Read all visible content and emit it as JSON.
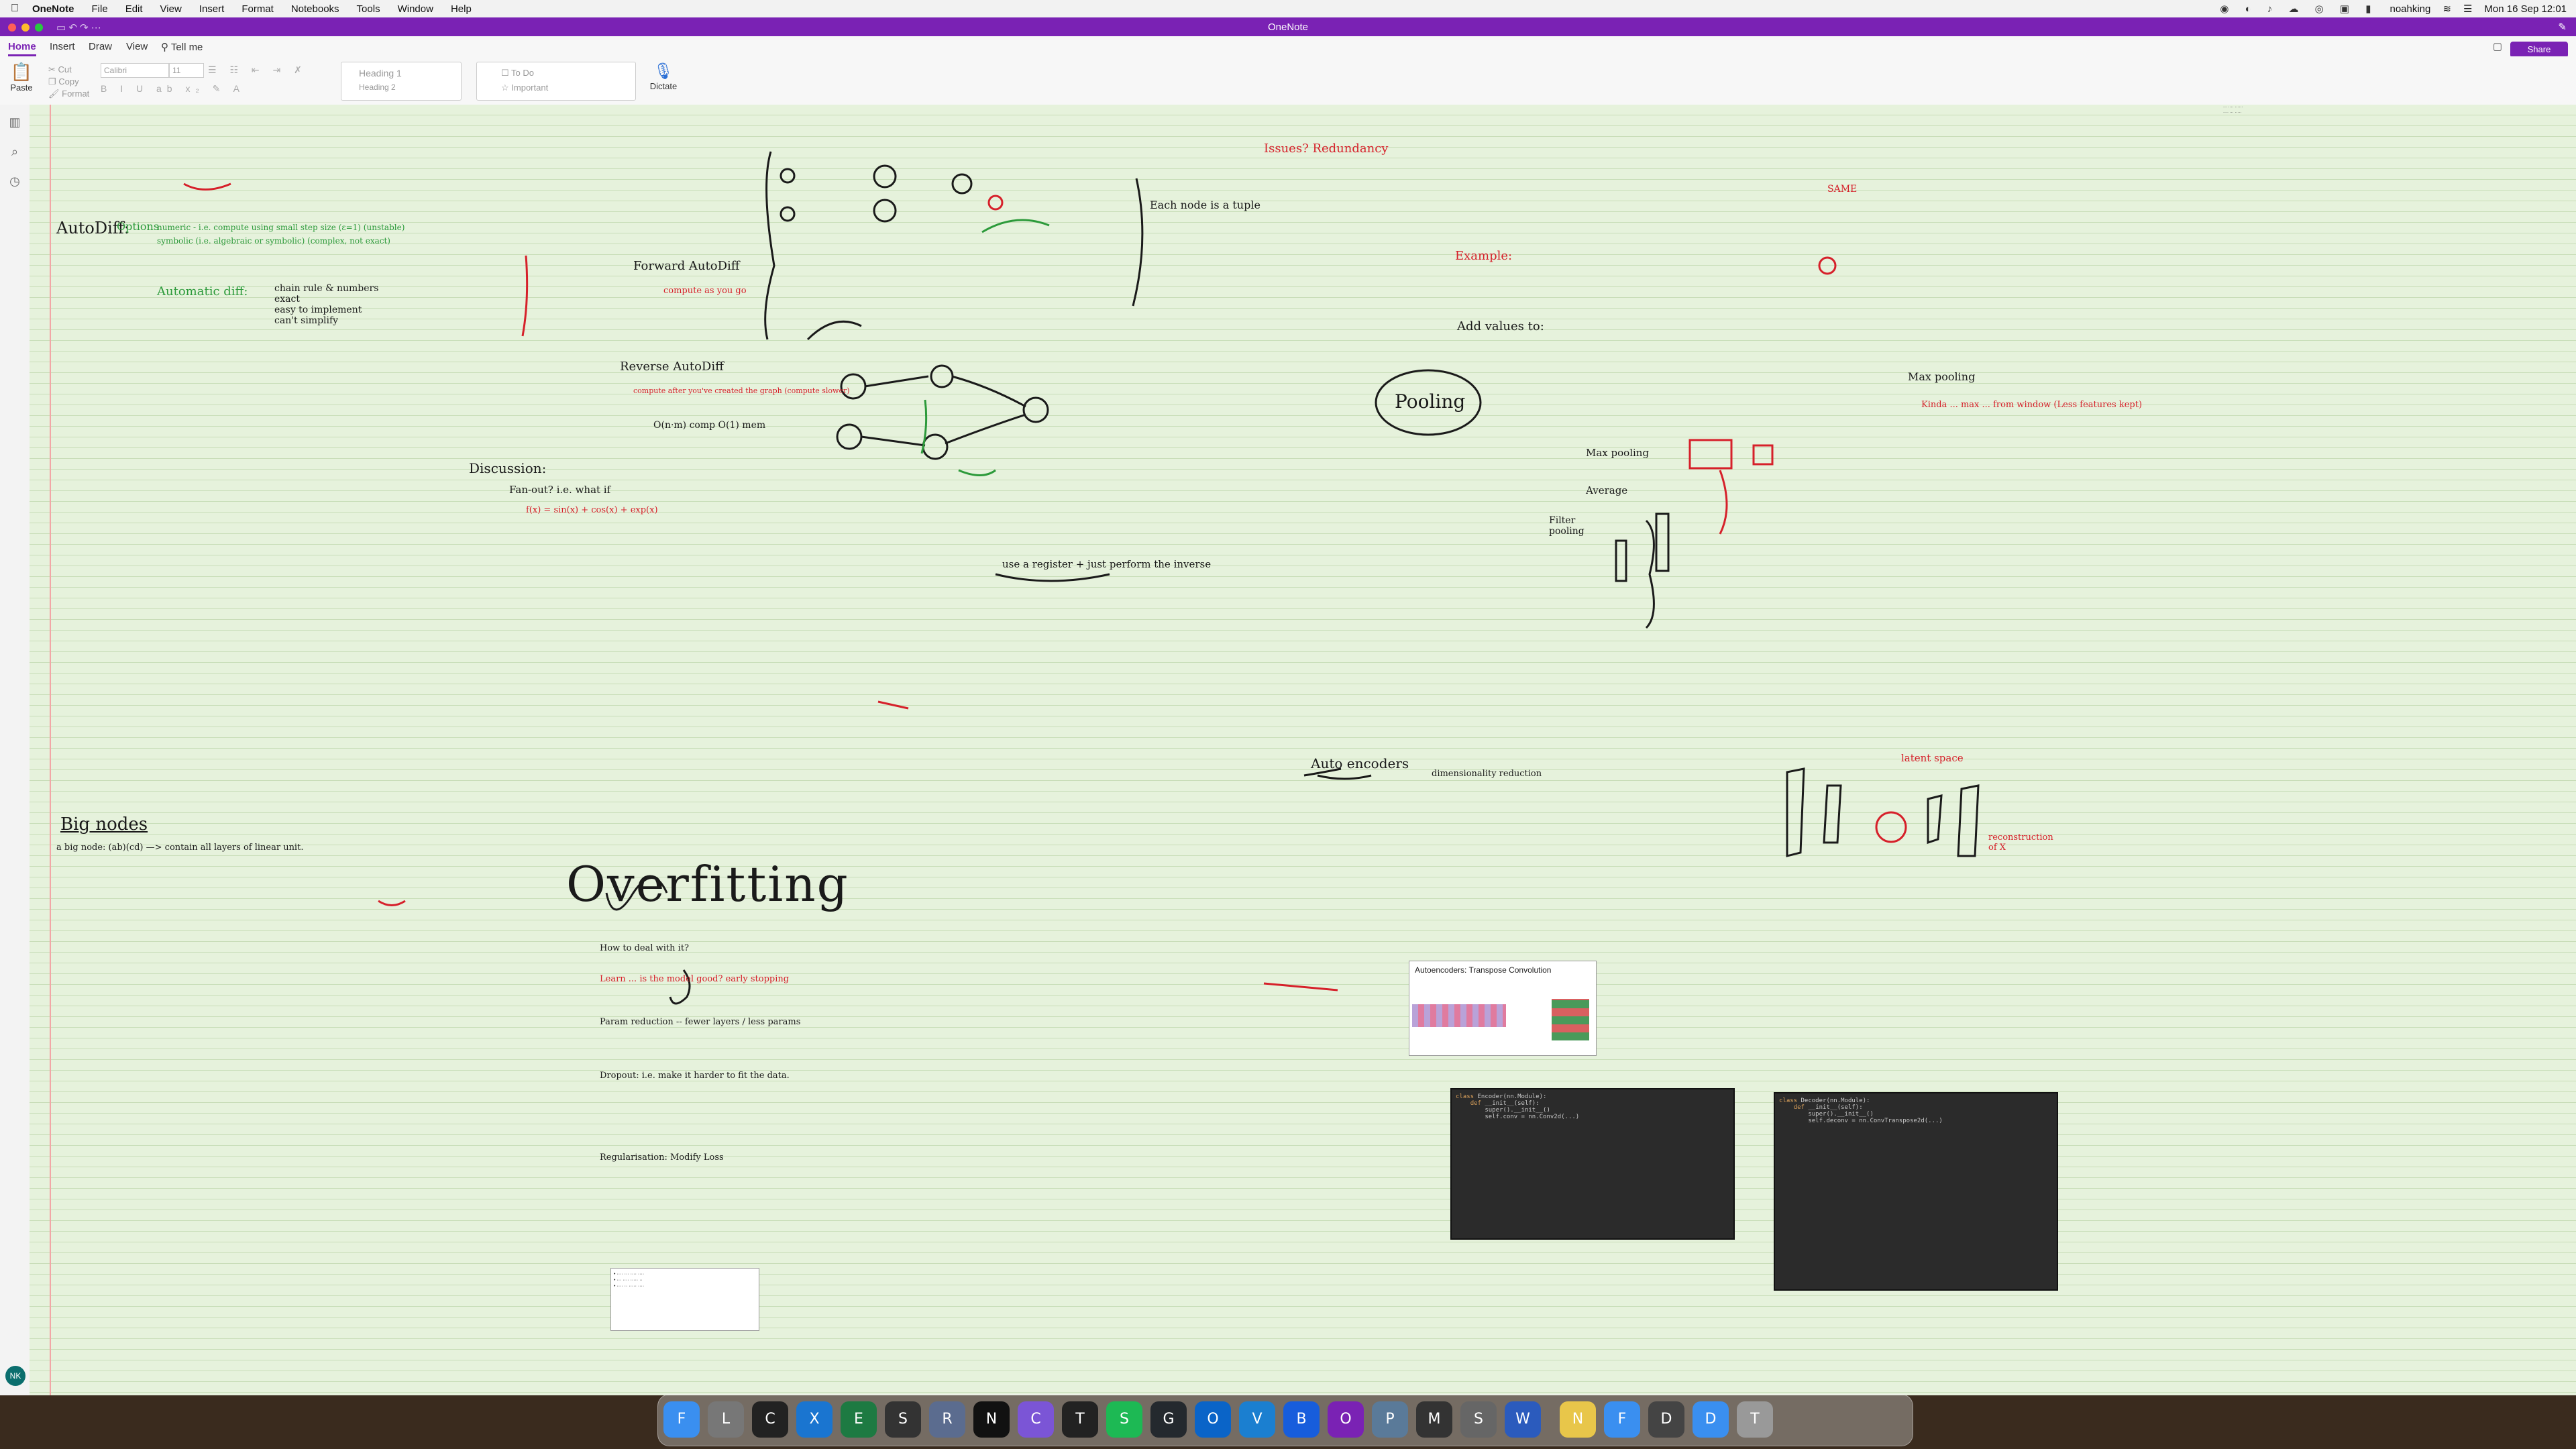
{
  "menubar": {
    "app_name": "OneNote",
    "items": [
      "File",
      "Edit",
      "View",
      "Insert",
      "Format",
      "Notebooks",
      "Tools",
      "Window",
      "Help"
    ],
    "user": "noahking",
    "datetime": "Mon 16 Sep  12:01"
  },
  "window": {
    "title": "OneNote",
    "share_label": "Share"
  },
  "ribbon": {
    "tabs": [
      "Home",
      "Insert",
      "Draw",
      "View",
      "Tell me"
    ],
    "paste_label": "Paste",
    "cut_label": "Cut",
    "copy_label": "Copy",
    "format_label": "Format",
    "font_name": "Calibri",
    "font_size": "11",
    "styles": [
      "Heading 1",
      "Heading 2"
    ],
    "tags": [
      "To Do",
      "Important"
    ],
    "dictate_label": "Dictate"
  },
  "user_initials": "NK",
  "notes": {
    "autodiff": "AutoDiff:",
    "options": "Options",
    "numeric": "numeric - i.e. compute using small step size (ε=1) (unstable)",
    "symbolic": "symbolic (i.e. algebraic or symbolic) (complex, not exact)",
    "automatic": "Automatic diff:",
    "auto_list": [
      "chain rule & numbers",
      "exact",
      "easy to implement",
      "can't simplify"
    ],
    "forward": "Forward AutoDiff",
    "forward_note": "compute as you go",
    "reverse": "Reverse AutoDiff",
    "reverse_note": "compute after you've created the graph (compute slower)",
    "complexity": "O(n·m) comp  O(1) mem",
    "discussion": "Discussion:",
    "fanout": "Fan-out? i.e. what if",
    "fanout_eq": "f(x) = sin(x) + cos(x) + exp(x)",
    "redundancy": "Issues? Redundancy",
    "each_node": "Each node is a tuple",
    "use_register": "use a register + just perform the inverse",
    "bignodes": "Big nodes",
    "bignodes_def": "a big node: (ab)(cd) —> contain all layers of linear unit.",
    "overfitting": "Overfitting",
    "overfit_items": [
      "How to deal with it?",
      "Learn ... is the model good? early stopping",
      "Param reduction  -- fewer layers / less params",
      "Dropout:  i.e. make it harder to fit the data.",
      "Regularisation:  Modify Loss"
    ],
    "pooling": "Pooling",
    "add_values": "Add values to:",
    "max_pooling": "Max pooling",
    "max_pool_note": "Kinda ... max ... from window (Less features kept)",
    "average": "Average",
    "filter_pooling": "Filter pooling",
    "example": "Example:",
    "same": "SAME",
    "autoencoders": "Auto encoders",
    "autoenc_note": "dimensionality reduction",
    "latent": "latent space",
    "reconstruction": "reconstruction of X",
    "thumb_title": "Autoencoders: Transpose Convolution"
  },
  "dock": {
    "apps": [
      "Finder",
      "Launchpad",
      "ChatGPT",
      "Xcode",
      "Excel",
      "Stage",
      "R",
      "Notion",
      "Copilot",
      "Terminal",
      "Spotify",
      "GitHub",
      "Outlook",
      "VS Code",
      "Bitwarden",
      "OneNote",
      "Preview",
      "Market",
      "System Settings",
      "Word",
      "Notes",
      "Files",
      "Display",
      "Downloads",
      "Trash"
    ]
  },
  "colors": {
    "accent": "#7a22b4",
    "page_bg": "#e6f2dc",
    "ink_red": "#d6202a",
    "ink_green": "#2c9a3a"
  }
}
